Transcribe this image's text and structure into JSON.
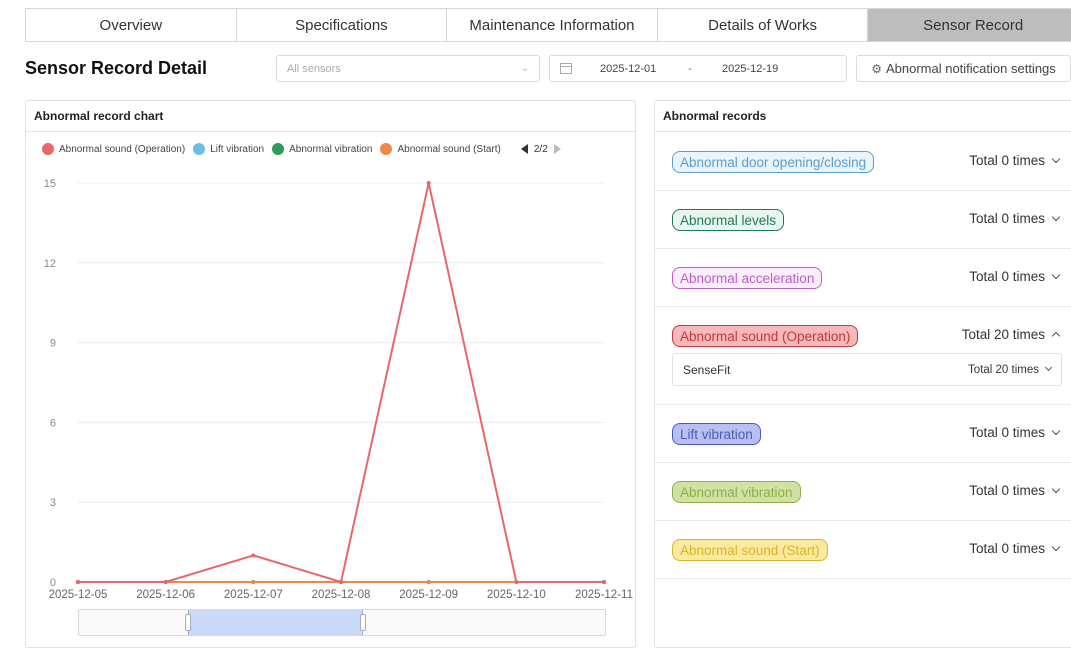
{
  "tabs": [
    {
      "label": "Overview",
      "active": false
    },
    {
      "label": "Specifications",
      "active": false
    },
    {
      "label": "Maintenance Information",
      "active": false
    },
    {
      "label": "Details of Works",
      "active": false
    },
    {
      "label": "Sensor Record",
      "active": true
    }
  ],
  "header": {
    "title": "Sensor Record Detail",
    "sensor_placeholder": "All sensors",
    "date_from": "2025-12-01",
    "date_separator": "-",
    "date_to": "2025-12-19",
    "notify_label": "Abnormal notification settings"
  },
  "chart_panel": {
    "title": "Abnormal record chart",
    "legend": [
      {
        "name": "Abnormal sound (Operation)",
        "color": "#e8676a"
      },
      {
        "name": "Lift vibration",
        "color": "#6cbde6"
      },
      {
        "name": "Abnormal vibration",
        "color": "#2e9a5b"
      },
      {
        "name": "Abnormal sound (Start)",
        "color": "#f0884a"
      }
    ],
    "legend_page": "2/2"
  },
  "chart_data": {
    "type": "line",
    "x": [
      "2025-12-05",
      "2025-12-06",
      "2025-12-07",
      "2025-12-08",
      "2025-12-09",
      "2025-12-10",
      "2025-12-11"
    ],
    "ylim": [
      0,
      15
    ],
    "yticks": [
      "0",
      "3",
      "6",
      "9",
      "12",
      "15"
    ],
    "series": [
      {
        "name": "Abnormal sound (Operation)",
        "color": "#e8676a",
        "values": [
          0,
          0,
          1,
          0,
          15,
          0,
          0
        ]
      },
      {
        "name": "Lift vibration",
        "color": "#6cbde6",
        "values": [
          0,
          0,
          0,
          0,
          0,
          0,
          0
        ]
      },
      {
        "name": "Abnormal vibration",
        "color": "#2e9a5b",
        "values": [
          0,
          0,
          0,
          0,
          0,
          0,
          0
        ]
      },
      {
        "name": "Abnormal sound (Start)",
        "color": "#f0884a",
        "values": [
          0,
          0,
          0,
          0,
          0,
          0,
          0
        ]
      }
    ],
    "grid": true
  },
  "records_panel": {
    "title": "Abnormal records",
    "records": [
      {
        "label": "Abnormal door opening/closing",
        "total": "Total 0 times",
        "color": "#5b9ecf",
        "bg": "#eaf4fb",
        "expanded": false
      },
      {
        "label": "Abnormal levels",
        "total": "Total 0 times",
        "color": "#1f7a57",
        "bg": "#e8f6ef",
        "expanded": false
      },
      {
        "label": "Abnormal acceleration",
        "total": "Total 0 times",
        "color": "#c05cc8",
        "bg": "#fbeefc",
        "expanded": false
      },
      {
        "label": "Abnormal sound (Operation)",
        "total": "Total 20 times",
        "color": "#c0393d",
        "bg": "#f6b8b8",
        "expanded": true
      },
      {
        "label": "Lift vibration",
        "total": "Total 0 times",
        "color": "#4a5bbd",
        "bg": "#b9bff0",
        "expanded": false
      },
      {
        "label": "Abnormal vibration",
        "total": "Total 0 times",
        "color": "#8fae4a",
        "bg": "#cfe2a4",
        "expanded": false
      },
      {
        "label": "Abnormal sound (Start)",
        "total": "Total 0 times",
        "color": "#d6b52a",
        "bg": "#fbe9a0",
        "expanded": false
      }
    ],
    "sub_item": {
      "name": "SenseFit",
      "total": "Total 20 times"
    }
  }
}
